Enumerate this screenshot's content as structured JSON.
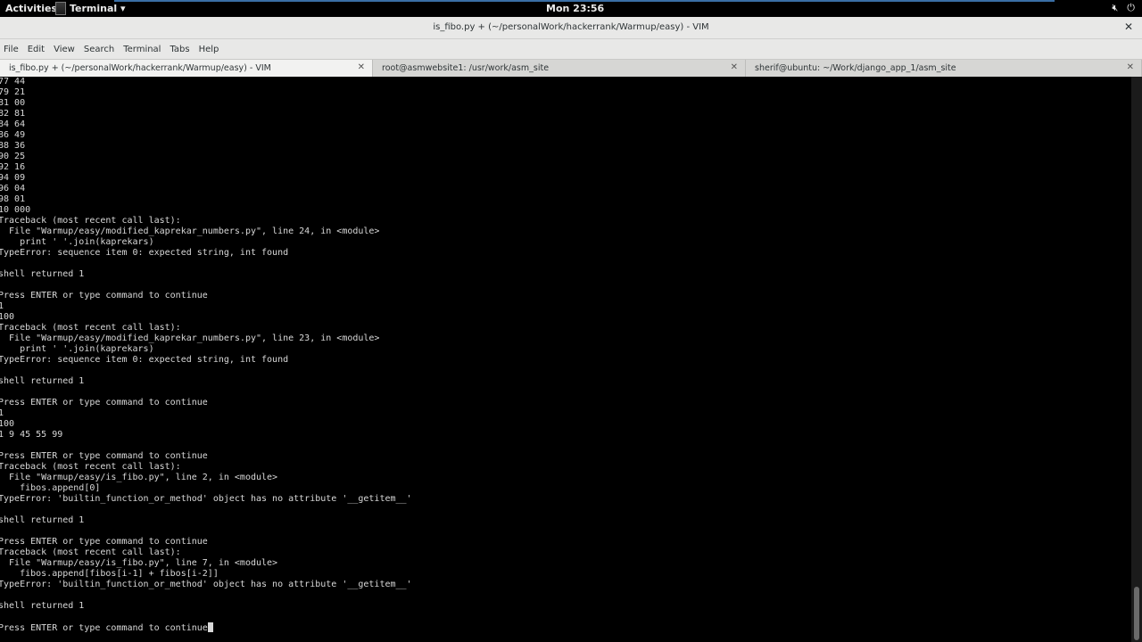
{
  "topbar": {
    "activities": "Activities",
    "app_name": "Terminal ▾",
    "clock": "Mon 23:56",
    "icons": [
      "volume-muted-icon",
      "power-icon"
    ]
  },
  "window": {
    "title": "is_fibo.py + (~/personalWork/hackerrank/Warmup/easy) - VIM"
  },
  "menu": [
    "File",
    "Edit",
    "View",
    "Search",
    "Terminal",
    "Tabs",
    "Help"
  ],
  "tabs": [
    {
      "label": "is_fibo.py + (~/personalWork/hackerrank/Warmup/easy) - VIM",
      "active": true
    },
    {
      "label": "root@asmwebsite1: /usr/work/asm_site",
      "active": false
    },
    {
      "label": "sherif@ubuntu: ~/Work/django_app_1/asm_site",
      "active": false
    }
  ],
  "terminal": {
    "lines": [
      "77 44",
      "79 21",
      "81 00",
      "82 81",
      "84 64",
      "86 49",
      "88 36",
      "90 25",
      "92 16",
      "94 09",
      "96 04",
      "98 01",
      "10 000",
      "Traceback (most recent call last):",
      "  File \"Warmup/easy/modified_kaprekar_numbers.py\", line 24, in <module>",
      "    print ' '.join(kaprekars)",
      "TypeError: sequence item 0: expected string, int found",
      "",
      "shell returned 1",
      "",
      "Press ENTER or type command to continue",
      "1",
      "100",
      "Traceback (most recent call last):",
      "  File \"Warmup/easy/modified_kaprekar_numbers.py\", line 23, in <module>",
      "    print ' '.join(kaprekars)",
      "TypeError: sequence item 0: expected string, int found",
      "",
      "shell returned 1",
      "",
      "Press ENTER or type command to continue",
      "1",
      "100",
      "1 9 45 55 99",
      "",
      "Press ENTER or type command to continue",
      "Traceback (most recent call last):",
      "  File \"Warmup/easy/is_fibo.py\", line 2, in <module>",
      "    fibos.append[0]",
      "TypeError: 'builtin_function_or_method' object has no attribute '__getitem__'",
      "",
      "shell returned 1",
      "",
      "Press ENTER or type command to continue",
      "Traceback (most recent call last):",
      "  File \"Warmup/easy/is_fibo.py\", line 7, in <module>",
      "    fibos.append[fibos[i-1] + fibos[i-2]]",
      "TypeError: 'builtin_function_or_method' object has no attribute '__getitem__'",
      "",
      "shell returned 1",
      "",
      "Press ENTER or type command to continue"
    ]
  }
}
